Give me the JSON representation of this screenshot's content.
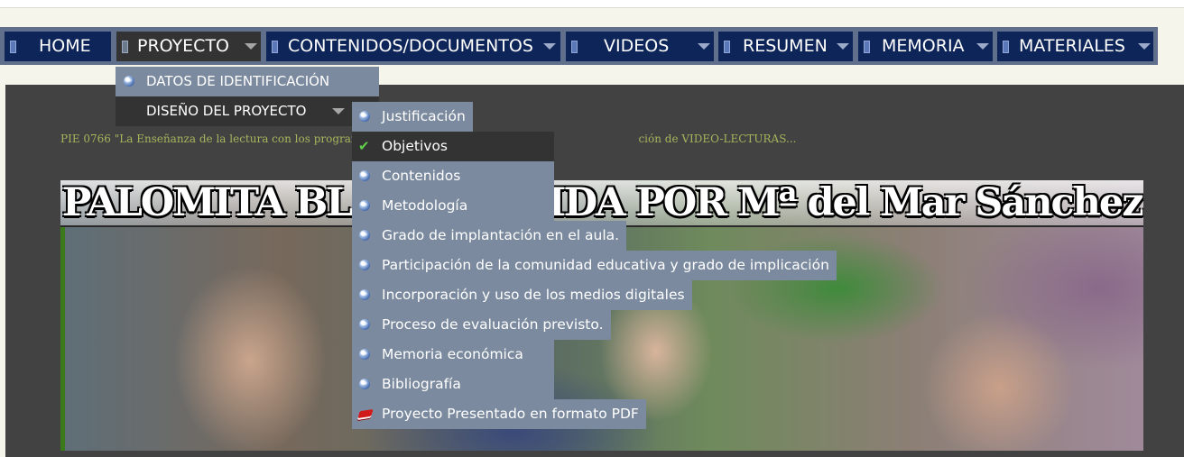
{
  "nav": {
    "items": [
      {
        "label": "HOME"
      },
      {
        "label": "PROYECTO"
      },
      {
        "label": "CONTENIDOS/DOCUMENTOS"
      },
      {
        "label": "VIDEOS"
      },
      {
        "label": "RESUMEN"
      },
      {
        "label": "MEMORIA"
      },
      {
        "label": "MATERIALES"
      }
    ]
  },
  "proyecto_menu": {
    "items": [
      {
        "label": "DATOS DE IDENTIFICACIÓN",
        "icon": "globe-icon"
      },
      {
        "label": "DISEÑO DEL PROYECTO",
        "icon": ""
      }
    ]
  },
  "diseno_menu": {
    "items": [
      {
        "label": "Justificación",
        "icon": "globe-icon"
      },
      {
        "label": "Objetivos",
        "icon": "check-icon"
      },
      {
        "label": "Contenidos",
        "icon": "globe-icon"
      },
      {
        "label": "Metodología",
        "icon": "globe-icon"
      },
      {
        "label": "Grado de implantación en el aula.",
        "icon": "globe-icon"
      },
      {
        "label": "Participación de la comunidad educativa y grado de implicación",
        "icon": "globe-icon"
      },
      {
        "label": "Incorporación y uso de los medios digitales",
        "icon": "globe-icon"
      },
      {
        "label": "Proceso de evaluación previsto.",
        "icon": "globe-icon"
      },
      {
        "label": "Memoria económica",
        "icon": "globe-icon"
      },
      {
        "label": "Bibliografía",
        "icon": "globe-icon"
      },
      {
        "label": "Proyecto Presentado en formato PDF",
        "icon": "pdf-icon"
      }
    ]
  },
  "content": {
    "pie_text_start": "PIE 0766 \"La Enseñanza de la lectura con los programa",
    "pie_text_end": "ción de VIDEO-LECTURAS...",
    "banner_title": "PALOMITA BLANCA, LEIDA POR Mª del Mar Sánchez Bermejo"
  },
  "colors": {
    "nav_bg": "#0d2559",
    "nav_active": "#333333",
    "menu_bg": "#7b8a9e",
    "panel_bg": "#424242"
  }
}
